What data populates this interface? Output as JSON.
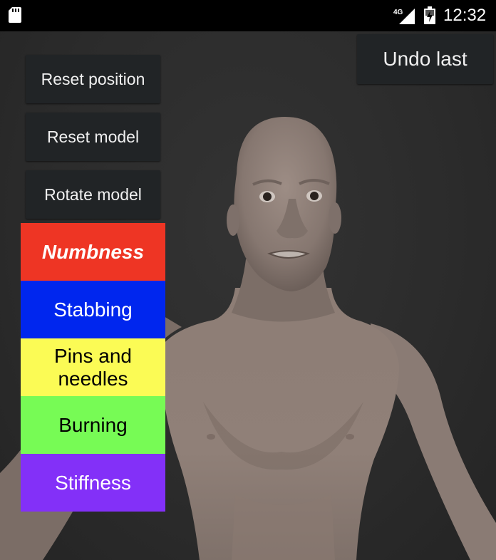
{
  "status_bar": {
    "time": "12:32",
    "network": "4G",
    "icons": [
      "sd-card-icon",
      "signal-icon",
      "battery-charging-icon"
    ]
  },
  "controls": {
    "reset_position": "Reset position",
    "reset_model": "Reset model",
    "rotate_model": "Rotate model",
    "undo_last": "Undo last"
  },
  "symptoms": [
    {
      "label": "Numbness",
      "color": "#ee3524",
      "text_color": "#ffffff",
      "selected": true
    },
    {
      "label": "Stabbing",
      "color": "#0026ee",
      "text_color": "#ffffff",
      "selected": false
    },
    {
      "label": "Pins and needles",
      "color": "#fbfb55",
      "text_color": "#000000",
      "selected": false
    },
    {
      "label": "Burning",
      "color": "#77fb55",
      "text_color": "#000000",
      "selected": false
    },
    {
      "label": "Stiffness",
      "color": "#8330f8",
      "text_color": "#ffffff",
      "selected": false
    }
  ],
  "colors": {
    "background": "#2b2b2b",
    "button": "#212426",
    "skin": "#8e7e76",
    "status_bar": "#000000"
  }
}
